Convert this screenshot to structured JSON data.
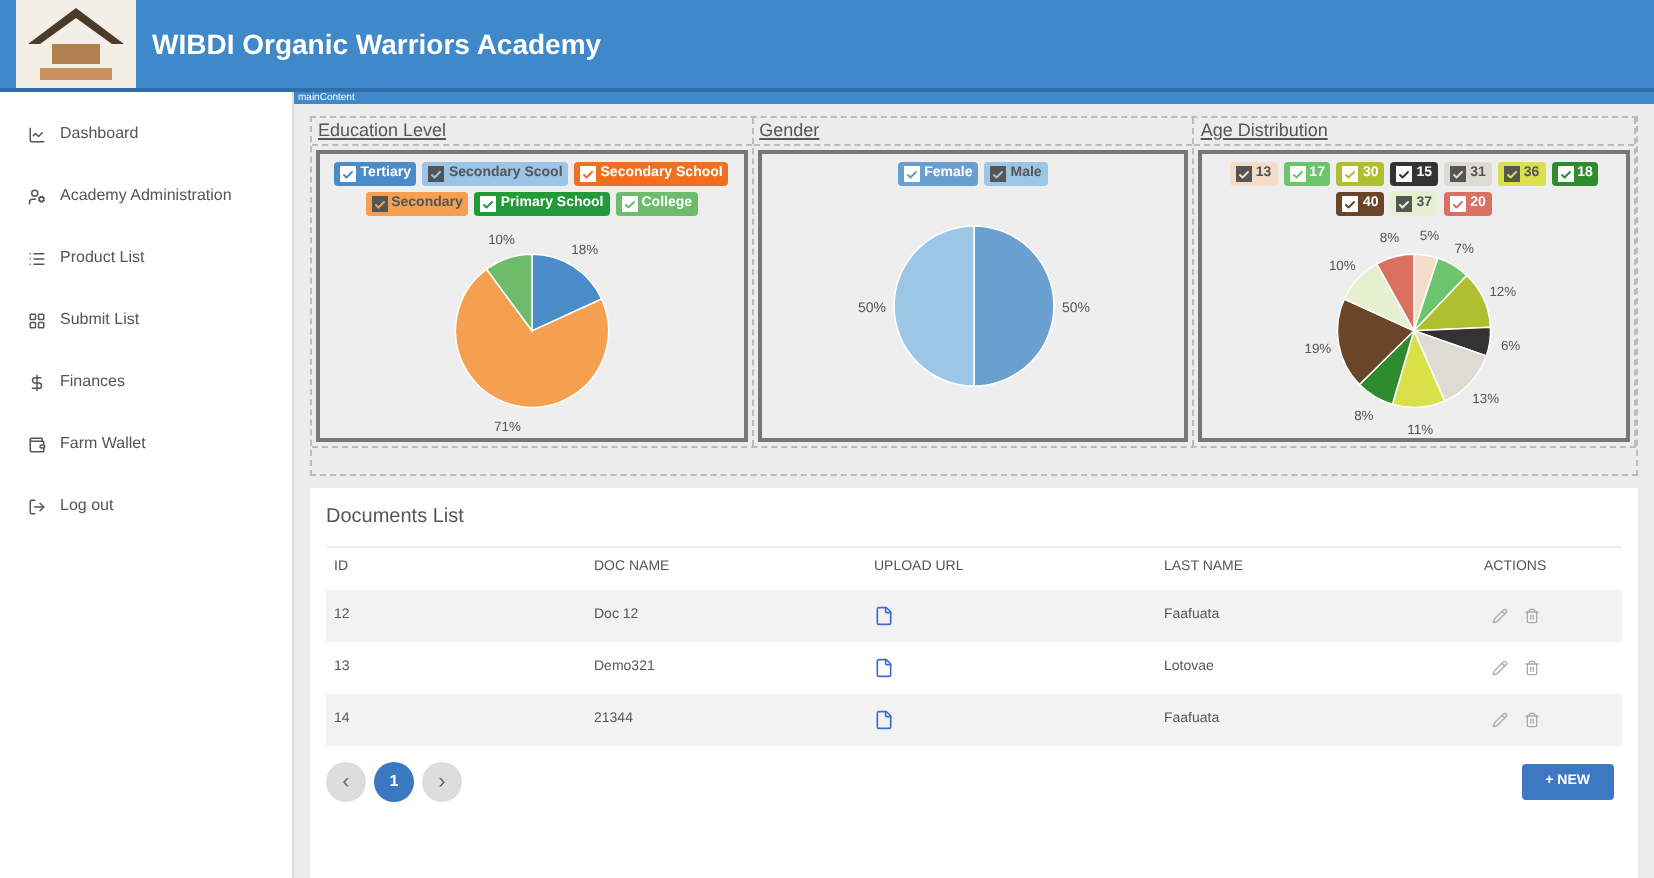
{
  "header": {
    "title": "WIBDI Organic Warriors Academy",
    "breadcrumb": "mainContent"
  },
  "sidebar": {
    "items": [
      {
        "label": "Dashboard",
        "kind": "chart"
      },
      {
        "label": "Academy Administration",
        "kind": "admin"
      },
      {
        "label": "Product List",
        "kind": "list"
      },
      {
        "label": "Submit List",
        "kind": "grid"
      },
      {
        "label": "Finances",
        "kind": "money"
      },
      {
        "label": "Farm Wallet",
        "kind": "wallet"
      },
      {
        "label": "Log out",
        "kind": "logout"
      }
    ]
  },
  "charts": [
    {
      "title": "Education Level",
      "legend": [
        {
          "checked": true
        },
        {
          "checked": true
        },
        {
          "checked": true
        },
        {
          "checked": true
        },
        {
          "checked": true
        },
        {
          "checked": true
        }
      ],
      "chart_data": {
        "type": "pie",
        "categories": [
          "Tertiary",
          "Secondary Scool",
          "Secondary School",
          "Secondary",
          "Primary School",
          "College"
        ],
        "series": [
          {
            "colors": [
              "#4a8cc8",
              "#9cc3e8",
              "#f07020",
              "#f5a050",
              "#239a3a",
              "#6cbc6c"
            ],
            "values": [
              18,
              0,
              0,
              71,
              0,
              10
            ]
          }
        ],
        "value_labels": [
          "18%",
          null,
          null,
          "71%",
          null,
          "10%"
        ]
      }
    },
    {
      "title": "Gender",
      "legend": [
        {
          "checked": true
        },
        {
          "checked": true
        }
      ],
      "chart_data": {
        "type": "pie",
        "categories": [
          "Female",
          "Male"
        ],
        "series": [
          {
            "colors": [
              "#6aa0d0",
              "#9cc6e6"
            ],
            "values": [
              50,
              50
            ]
          }
        ],
        "value_labels": [
          "50%",
          "50%"
        ]
      }
    },
    {
      "title": "Age Distribution",
      "legend": [
        {
          "checked": true
        },
        {
          "checked": true
        },
        {
          "checked": true
        },
        {
          "checked": true
        },
        {
          "checked": true
        },
        {
          "checked": true
        },
        {
          "checked": true
        },
        {
          "checked": true
        },
        {
          "checked": true
        },
        {
          "checked": true
        }
      ],
      "chart_data": {
        "type": "pie",
        "categories": [
          "13",
          "17",
          "30",
          "15",
          "31",
          "36",
          "18",
          "40",
          "37",
          "20"
        ],
        "series": [
          {
            "colors": [
              "#f3ddc8",
              "#6cc46c",
              "#b0bf30",
              "#333333",
              "#dedcd2",
              "#d9e04a",
              "#2e8b2e",
              "#6a4528",
              "#e6efd0",
              "#d97060"
            ],
            "values": [
              5,
              7,
              12,
              6,
              13,
              11,
              8,
              19,
              10,
              8
            ]
          }
        ],
        "value_labels": [
          "5%",
          "7%",
          "12%",
          "6%",
          "13%",
          "11%",
          "8%",
          "19%",
          "10%",
          "8%"
        ]
      }
    }
  ],
  "documents": {
    "title": "Documents List",
    "columns": [
      "ID",
      "DOC NAME",
      "UPLOAD URL",
      "LAST NAME",
      "ACTIONS"
    ],
    "rows": [
      {
        "id": "12",
        "doc_name": "Doc 12",
        "last_name": "Faafuata"
      },
      {
        "id": "13",
        "doc_name": "Demo321",
        "last_name": "Lotovae"
      },
      {
        "id": "14",
        "doc_name": "21344",
        "last_name": "Faafuata"
      }
    ],
    "pagination": {
      "prev": "‹",
      "next": "›",
      "pages": [
        {
          "label": "1",
          "selected": true
        }
      ]
    },
    "new_button": "+ NEW"
  }
}
